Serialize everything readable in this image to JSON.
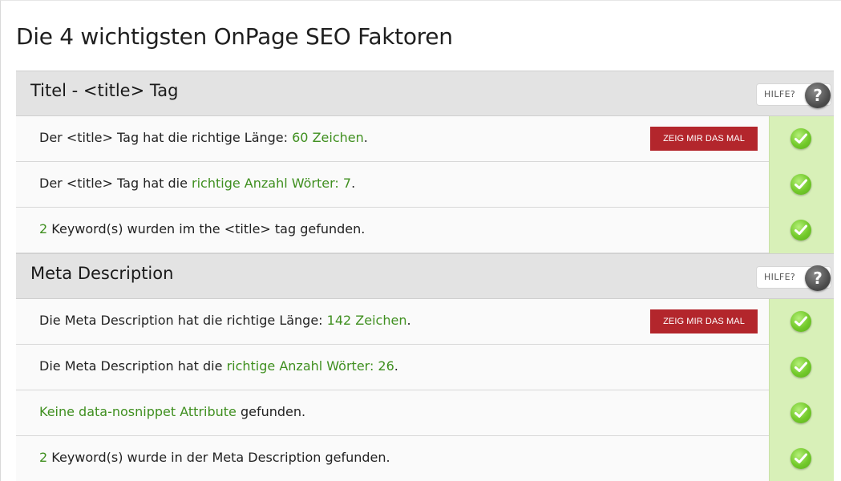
{
  "page_title": "Die 4 wichtigsten OnPage SEO Faktoren",
  "colors": {
    "highlight": "#3f8f1f",
    "button": "#b3262c",
    "status_ok_bg": "#d8f0b8"
  },
  "sections": [
    {
      "title": "Titel - <title> Tag",
      "help_label": "HILFE?",
      "help_icon": "?",
      "rows": [
        {
          "pre": "Der <title> Tag hat die richtige Länge: ",
          "hl": "60 Zeichen",
          "post": ".",
          "button": "ZEIG MIR DAS MAL",
          "status": "ok-check-icon"
        },
        {
          "pre": "Der <title> Tag hat die ",
          "hl": "richtige Anzahl Wörter: 7",
          "post": ".",
          "status": "ok-check-icon"
        },
        {
          "pre": "",
          "hl": "2",
          "post": " Keyword(s) wurden im the <title> tag gefunden.",
          "status": "ok-check-icon"
        }
      ]
    },
    {
      "title": "Meta Description",
      "help_label": "HILFE?",
      "help_icon": "?",
      "rows": [
        {
          "pre": "Die Meta Description hat die richtige Länge: ",
          "hl": "142 Zeichen",
          "post": ".",
          "button": "ZEIG MIR DAS MAL",
          "status": "ok-check-icon"
        },
        {
          "pre": "Die Meta Description hat die ",
          "hl": "richtige Anzahl Wörter: 26",
          "post": ".",
          "status": "ok-check-icon"
        },
        {
          "pre": "",
          "hl": "Keine data-nosnippet Attribute",
          "post": " gefunden.",
          "status": "ok-check-icon"
        },
        {
          "pre": "",
          "hl": "2",
          "post": " Keyword(s) wurde in der Meta Description gefunden.",
          "status": "ok-check-icon"
        }
      ]
    }
  ]
}
